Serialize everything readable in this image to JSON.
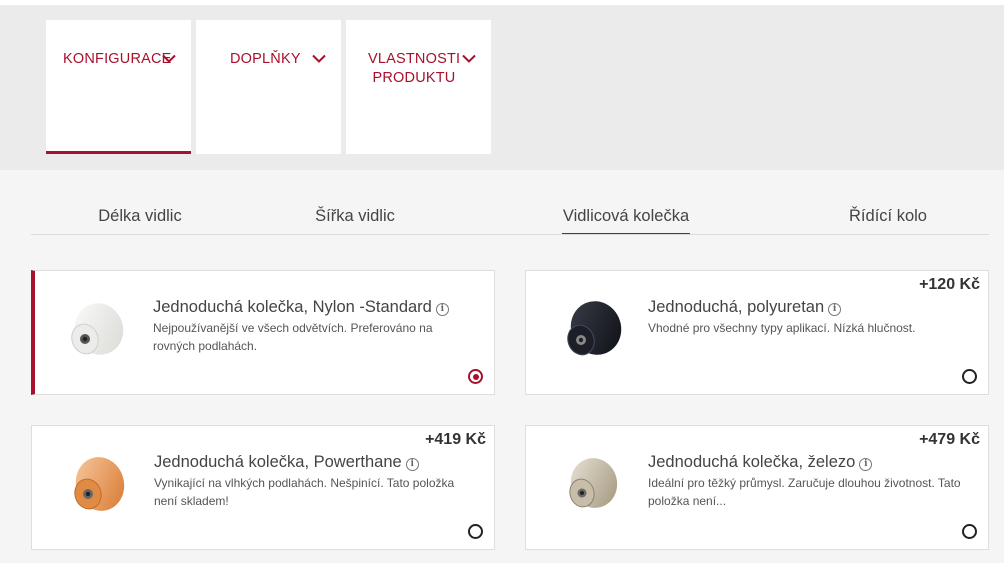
{
  "colors": {
    "accent": "#a8102c",
    "band": "#ebebeb",
    "page": "#f5f5f5"
  },
  "menu": {
    "tabs": [
      {
        "label": "KONFIGURACE",
        "active": true,
        "icon": "chevron-down-icon"
      },
      {
        "label": "DOPLŇKY",
        "active": false,
        "icon": "chevron-down-icon"
      },
      {
        "label": "VLASTNOSTI PRODUKTU",
        "active": false,
        "icon": "chevron-down-icon"
      }
    ]
  },
  "subtabs": [
    {
      "label": "Délka vidlic"
    },
    {
      "label": "Šířka vidlic"
    },
    {
      "label": "Vidlicová kolečka",
      "active": true
    },
    {
      "label": "Řídící kolo"
    }
  ],
  "options": [
    {
      "title": "Jednoduchá kolečka, Nylon -Standard",
      "desc": "Nejpoužívanější ve všech odvětvích. Preferováno na rovných podlahách.",
      "price": "",
      "selected": true,
      "image": "white-nylon-wheel"
    },
    {
      "title": "Jednoduchá, polyuretan",
      "desc": "Vhodné pro všechny typy aplikací. Nízká hlučnost.",
      "price": "+120 Kč",
      "selected": false,
      "image": "black-polyurethane-wheel"
    },
    {
      "title": "Jednoduchá kolečka, Powerthane",
      "desc": "Vynikající na vlhkých podlahách. Nešpinící. Tato položka není skladem!",
      "price": "+419 Kč",
      "selected": false,
      "image": "orange-powerthane-wheel"
    },
    {
      "title": "Jednoduchá kolečka, železo",
      "desc": "Ideální pro těžký průmysl. Zaručuje dlouhou životnost. Tato položka není...",
      "price": "+479 Kč",
      "selected": false,
      "image": "steel-wheel"
    }
  ],
  "info_icon_glyph": "i"
}
